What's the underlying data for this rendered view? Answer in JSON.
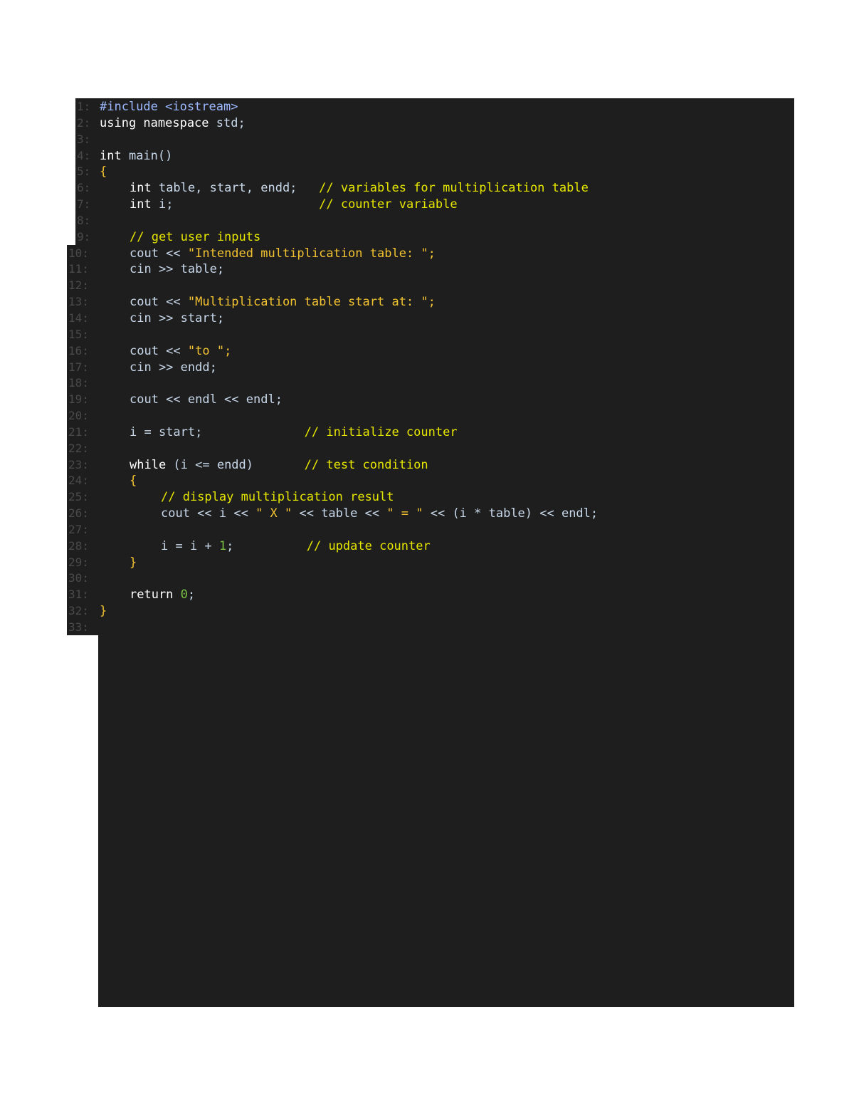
{
  "code": {
    "language": "C++",
    "lines": [
      {
        "num": "1:",
        "tokens": [
          {
            "t": "#include <iostream>",
            "c": "pp"
          }
        ]
      },
      {
        "num": "2:",
        "tokens": [
          {
            "t": "using namespace ",
            "c": "kw"
          },
          {
            "t": "std;",
            "c": "id"
          }
        ]
      },
      {
        "num": "3:",
        "tokens": []
      },
      {
        "num": "4:",
        "tokens": [
          {
            "t": "int ",
            "c": "kw"
          },
          {
            "t": "main()",
            "c": "id"
          }
        ]
      },
      {
        "num": "5:",
        "tokens": [
          {
            "t": "{",
            "c": "br"
          }
        ]
      },
      {
        "num": "6:",
        "indent": 1,
        "tokens": [
          {
            "t": "int ",
            "c": "kw"
          },
          {
            "t": "table, start, endd;",
            "c": "id"
          },
          {
            "t": "   // variables for multiplication table",
            "c": "cm"
          }
        ]
      },
      {
        "num": "7:",
        "indent": 1,
        "tokens": [
          {
            "t": "int ",
            "c": "kw"
          },
          {
            "t": "i;",
            "c": "id"
          },
          {
            "t": "                    // counter variable",
            "c": "cm"
          }
        ]
      },
      {
        "num": "8:",
        "tokens": []
      },
      {
        "num": "9:",
        "indent": 1,
        "tokens": [
          {
            "t": "// get user inputs",
            "c": "cm"
          }
        ]
      },
      {
        "num": "10:",
        "indent": 1,
        "tokens": [
          {
            "t": "cout << ",
            "c": "id"
          },
          {
            "t": "\"Intended multiplication table: \";",
            "c": "str"
          }
        ]
      },
      {
        "num": "11:",
        "indent": 1,
        "tokens": [
          {
            "t": "cin >> table;",
            "c": "id"
          }
        ]
      },
      {
        "num": "12:",
        "tokens": []
      },
      {
        "num": "13:",
        "indent": 1,
        "tokens": [
          {
            "t": "cout << ",
            "c": "id"
          },
          {
            "t": "\"Multiplication table start at: \";",
            "c": "str"
          }
        ]
      },
      {
        "num": "14:",
        "indent": 1,
        "tokens": [
          {
            "t": "cin >> start;",
            "c": "id"
          }
        ]
      },
      {
        "num": "15:",
        "tokens": []
      },
      {
        "num": "16:",
        "indent": 1,
        "tokens": [
          {
            "t": "cout << ",
            "c": "id"
          },
          {
            "t": "\"to \";",
            "c": "str"
          }
        ]
      },
      {
        "num": "17:",
        "indent": 1,
        "tokens": [
          {
            "t": "cin >> endd;",
            "c": "id"
          }
        ]
      },
      {
        "num": "18:",
        "tokens": []
      },
      {
        "num": "19:",
        "indent": 1,
        "tokens": [
          {
            "t": "cout << endl << endl;",
            "c": "id"
          }
        ]
      },
      {
        "num": "20:",
        "tokens": []
      },
      {
        "num": "21:",
        "indent": 1,
        "tokens": [
          {
            "t": "i = start;",
            "c": "id"
          },
          {
            "t": "              // initialize counter",
            "c": "cm"
          }
        ]
      },
      {
        "num": "22:",
        "tokens": []
      },
      {
        "num": "23:",
        "indent": 1,
        "tokens": [
          {
            "t": "while ",
            "c": "kw"
          },
          {
            "t": "(i <= endd)",
            "c": "id"
          },
          {
            "t": "       // test condition",
            "c": "cm"
          }
        ]
      },
      {
        "num": "24:",
        "indent": 1,
        "tokens": [
          {
            "t": "{",
            "c": "br"
          }
        ]
      },
      {
        "num": "25:",
        "indent": 2,
        "tokens": [
          {
            "t": "// display multiplication result",
            "c": "cm"
          }
        ]
      },
      {
        "num": "26:",
        "indent": 2,
        "tokens": [
          {
            "t": "cout << i << ",
            "c": "id"
          },
          {
            "t": "\" X \"",
            "c": "str"
          },
          {
            "t": " << table << ",
            "c": "id"
          },
          {
            "t": "\" = \"",
            "c": "str"
          },
          {
            "t": " << (i * table) << endl;",
            "c": "id"
          }
        ]
      },
      {
        "num": "27:",
        "tokens": []
      },
      {
        "num": "28:",
        "indent": 2,
        "tokens": [
          {
            "t": "i = i + ",
            "c": "id"
          },
          {
            "t": "1",
            "c": "num"
          },
          {
            "t": ";",
            "c": "id"
          },
          {
            "t": "          // update counter",
            "c": "cm"
          }
        ]
      },
      {
        "num": "29:",
        "indent": 1,
        "tokens": [
          {
            "t": "}",
            "c": "br"
          }
        ]
      },
      {
        "num": "30:",
        "tokens": []
      },
      {
        "num": "31:",
        "indent": 1,
        "tokens": [
          {
            "t": "return ",
            "c": "kw"
          },
          {
            "t": "0",
            "c": "num"
          },
          {
            "t": ";",
            "c": "id"
          }
        ]
      },
      {
        "num": "32:",
        "tokens": [
          {
            "t": "}",
            "c": "br"
          }
        ]
      },
      {
        "num": "33:",
        "tokens": []
      }
    ]
  }
}
